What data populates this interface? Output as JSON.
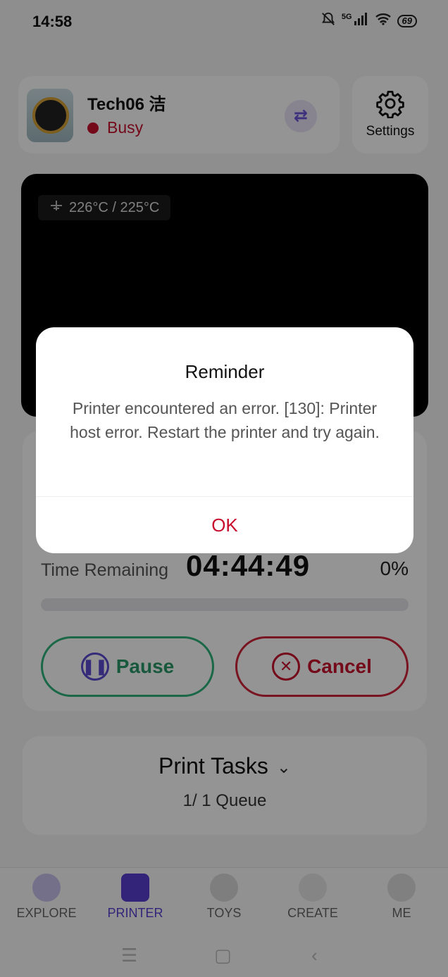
{
  "status_bar": {
    "time": "14:58",
    "network": "5G",
    "battery": "69"
  },
  "header": {
    "printer_name": "Tech06 洁",
    "status": "Busy",
    "settings_label": "Settings"
  },
  "camera": {
    "temperature": "226°C / 225°C"
  },
  "progress": {
    "time_label": "Time Remaining",
    "time_value": "04:44:49",
    "percent_text": "0%",
    "percent_value": 0,
    "pause_label": "Pause",
    "cancel_label": "Cancel"
  },
  "tasks": {
    "title": "Print Tasks",
    "queue": "1/ 1 Queue"
  },
  "nav": {
    "items": [
      {
        "label": "EXPLORE"
      },
      {
        "label": "PRINTER"
      },
      {
        "label": "TOYS"
      },
      {
        "label": "CREATE"
      },
      {
        "label": "ME"
      }
    ]
  },
  "dialog": {
    "title": "Reminder",
    "message": "Printer encountered an error. [130]: Printer host error. Restart the printer and try again.",
    "ok_label": "OK"
  },
  "colors": {
    "accent": "#c8102e",
    "brand": "#5a3fd0",
    "success": "#2db37a"
  }
}
